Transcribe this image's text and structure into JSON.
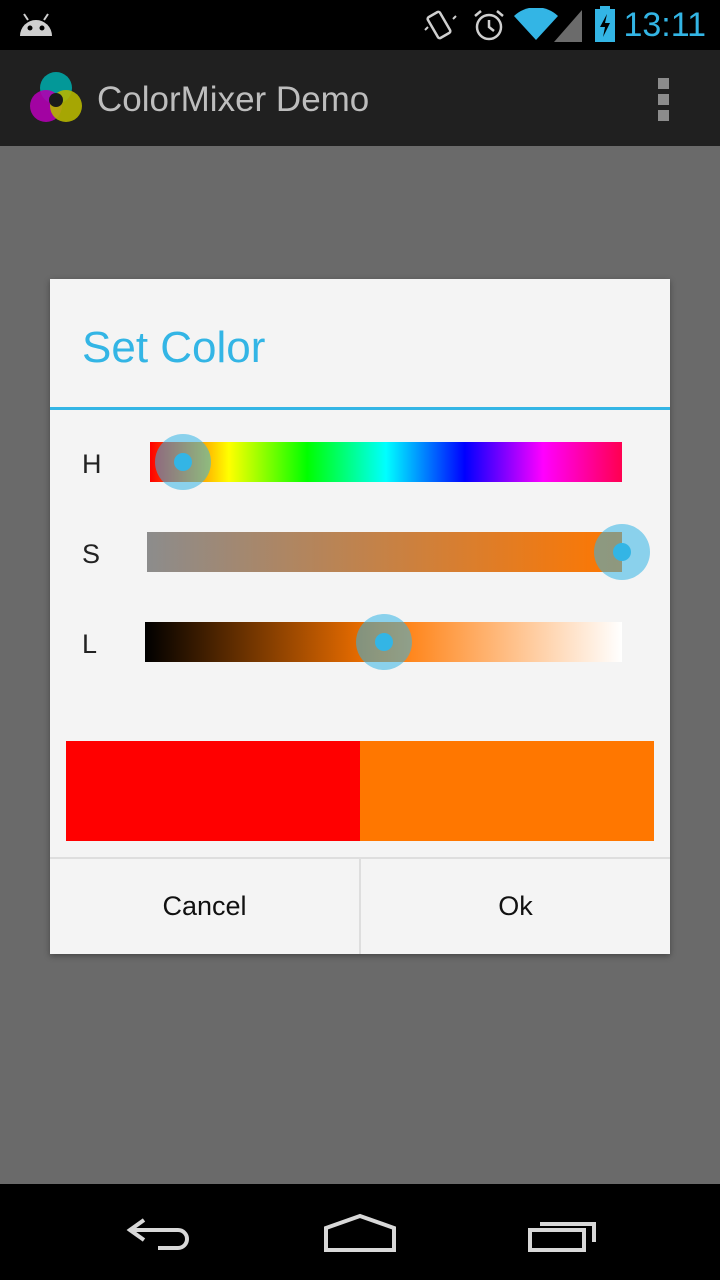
{
  "status_bar": {
    "time": "13:11",
    "icons": [
      "android-notification-icon",
      "vibrate-icon",
      "alarm-icon",
      "wifi-icon",
      "signal-icon",
      "battery-charging-icon"
    ]
  },
  "action_bar": {
    "title": "ColorMixer Demo",
    "app_icon": "colormixer-logo-icon",
    "menu_icon": "overflow-menu-icon"
  },
  "dialog": {
    "title": "Set Color",
    "sliders": [
      {
        "label": "H",
        "value_fraction": 0.07
      },
      {
        "label": "S",
        "value_fraction": 1.0
      },
      {
        "label": "L",
        "value_fraction": 0.5
      }
    ],
    "swatches": {
      "original": "#ff0000",
      "new": "#ff7700"
    },
    "buttons": {
      "cancel": "Cancel",
      "ok": "Ok"
    }
  },
  "colors": {
    "accent": "#33b5e5"
  },
  "nav_bar": {
    "icons": [
      "back-icon",
      "home-icon",
      "recents-icon"
    ]
  }
}
